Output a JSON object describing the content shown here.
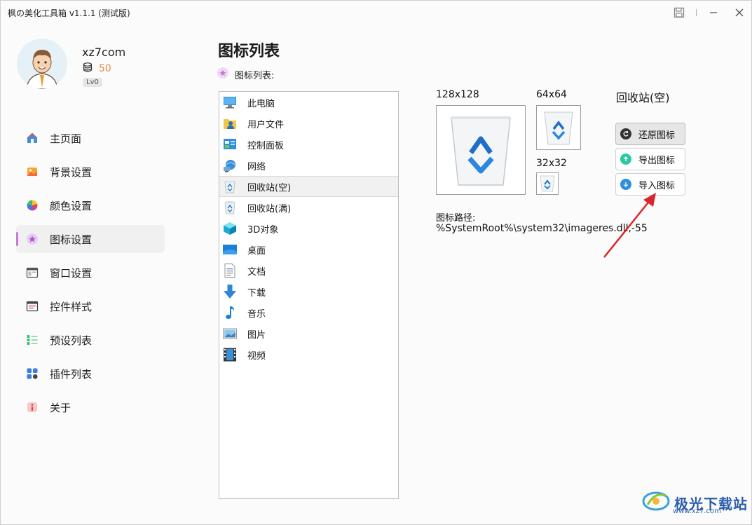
{
  "window": {
    "title": "枫の美化工具箱 v1.1.1 (测试版)"
  },
  "user": {
    "name": "xz7com",
    "coins": "50",
    "level": "Lv0"
  },
  "nav": {
    "items": [
      {
        "label": "主页面",
        "icon": "home-icon"
      },
      {
        "label": "背景设置",
        "icon": "image-icon"
      },
      {
        "label": "颜色设置",
        "icon": "color-wheel-icon"
      },
      {
        "label": "图标设置",
        "icon": "star-icon",
        "active": true
      },
      {
        "label": "窗口设置",
        "icon": "window-icon"
      },
      {
        "label": "控件样式",
        "icon": "widget-icon"
      },
      {
        "label": "预设列表",
        "icon": "list-icon"
      },
      {
        "label": "插件列表",
        "icon": "apps-icon"
      },
      {
        "label": "关于",
        "icon": "info-icon"
      }
    ]
  },
  "main": {
    "title": "图标列表",
    "list_label": "图标列表:",
    "icon_list": [
      {
        "label": "此电脑",
        "icon": "computer-icon"
      },
      {
        "label": "用户文件",
        "icon": "user-folder-icon"
      },
      {
        "label": "控制面板",
        "icon": "control-panel-icon"
      },
      {
        "label": "网络",
        "icon": "network-icon"
      },
      {
        "label": "回收站(空)",
        "icon": "recycle-bin-empty-icon",
        "selected": true
      },
      {
        "label": "回收站(满)",
        "icon": "recycle-bin-full-icon"
      },
      {
        "label": "3D对象",
        "icon": "cube-icon"
      },
      {
        "label": "桌面",
        "icon": "desktop-icon"
      },
      {
        "label": "文档",
        "icon": "document-icon"
      },
      {
        "label": "下载",
        "icon": "download-icon"
      },
      {
        "label": "音乐",
        "icon": "music-icon"
      },
      {
        "label": "图片",
        "icon": "picture-icon"
      },
      {
        "label": "视频",
        "icon": "video-icon"
      }
    ],
    "preview": {
      "size_large": "128x128",
      "size_medium": "64x64",
      "size_small": "32x32",
      "name": "回收站(空)",
      "path_label": "图标路径:",
      "path": "%SystemRoot%\\system32\\imageres.dll,-55"
    },
    "buttons": {
      "restore": "还原图标",
      "export": "导出图标",
      "import": "导入图标"
    }
  },
  "watermark": {
    "text": "极光下载站",
    "url": "www.xz7.com"
  },
  "colors": {
    "accent": "#c77ad6",
    "coin": "#e88a3c",
    "arrow": "#d9262b"
  }
}
